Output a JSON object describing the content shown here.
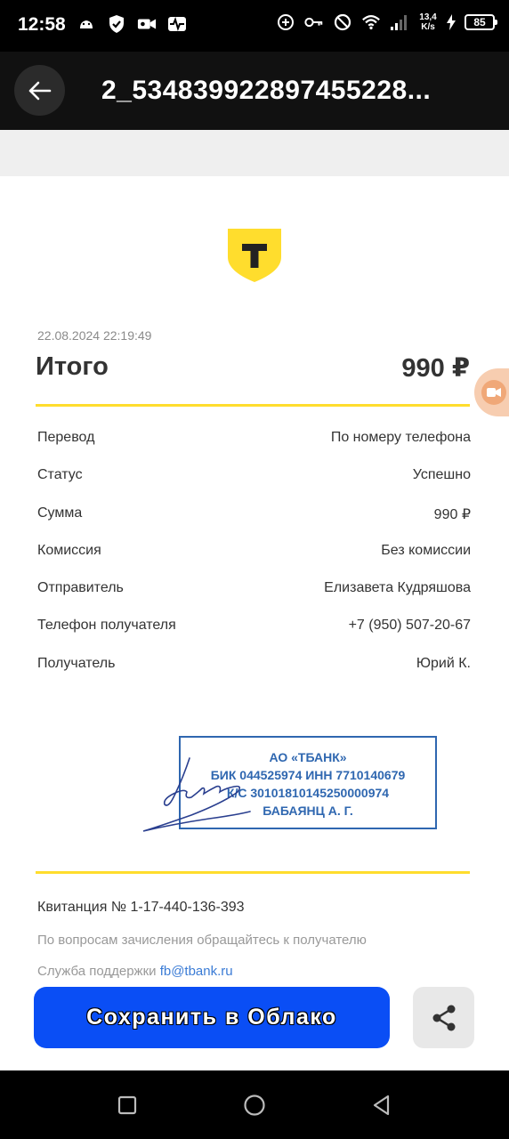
{
  "status_bar": {
    "time": "12:58",
    "net_speed_value": "13,4",
    "net_speed_unit": "K/s",
    "battery": "85"
  },
  "app_bar": {
    "title": "2_534839922897455228..."
  },
  "receipt": {
    "datetime": "22.08.2024  22:19:49",
    "total_label": "Итого",
    "total_amount": "990 ₽",
    "rows": [
      {
        "label": "Перевод",
        "value": "По номеру телефона"
      },
      {
        "label": "Статус",
        "value": "Успешно"
      },
      {
        "label": "Сумма",
        "value": "990 ₽"
      },
      {
        "label": "Комиссия",
        "value": "Без комиссии"
      },
      {
        "label": "Отправитель",
        "value": "Елизавета Кудряшова"
      },
      {
        "label": "Телефон получателя",
        "value": "+7 (950) 507-20-67"
      },
      {
        "label": "Получатель",
        "value": "Юрий К."
      }
    ],
    "stamp": {
      "line1": "АО «ТБАНК»",
      "line2": "БИК 044525974 ИНН 7710140679",
      "line3": "К/С 30101810145250000974",
      "line4": "БАБАЯНЦ А. Г."
    },
    "receipt_number": "Квитанция  № 1-17-440-136-393",
    "note": "По вопросам зачисления обращайтесь к получателю",
    "support_label": "Служба поддержки ",
    "support_email": "fb@tbank.ru"
  },
  "actions": {
    "save_cloud": "Сохранить в Облако"
  },
  "colors": {
    "accent_yellow": "#ffdd2d",
    "button_blue": "#0a4ef5",
    "stamp_blue": "#2f67b0"
  }
}
